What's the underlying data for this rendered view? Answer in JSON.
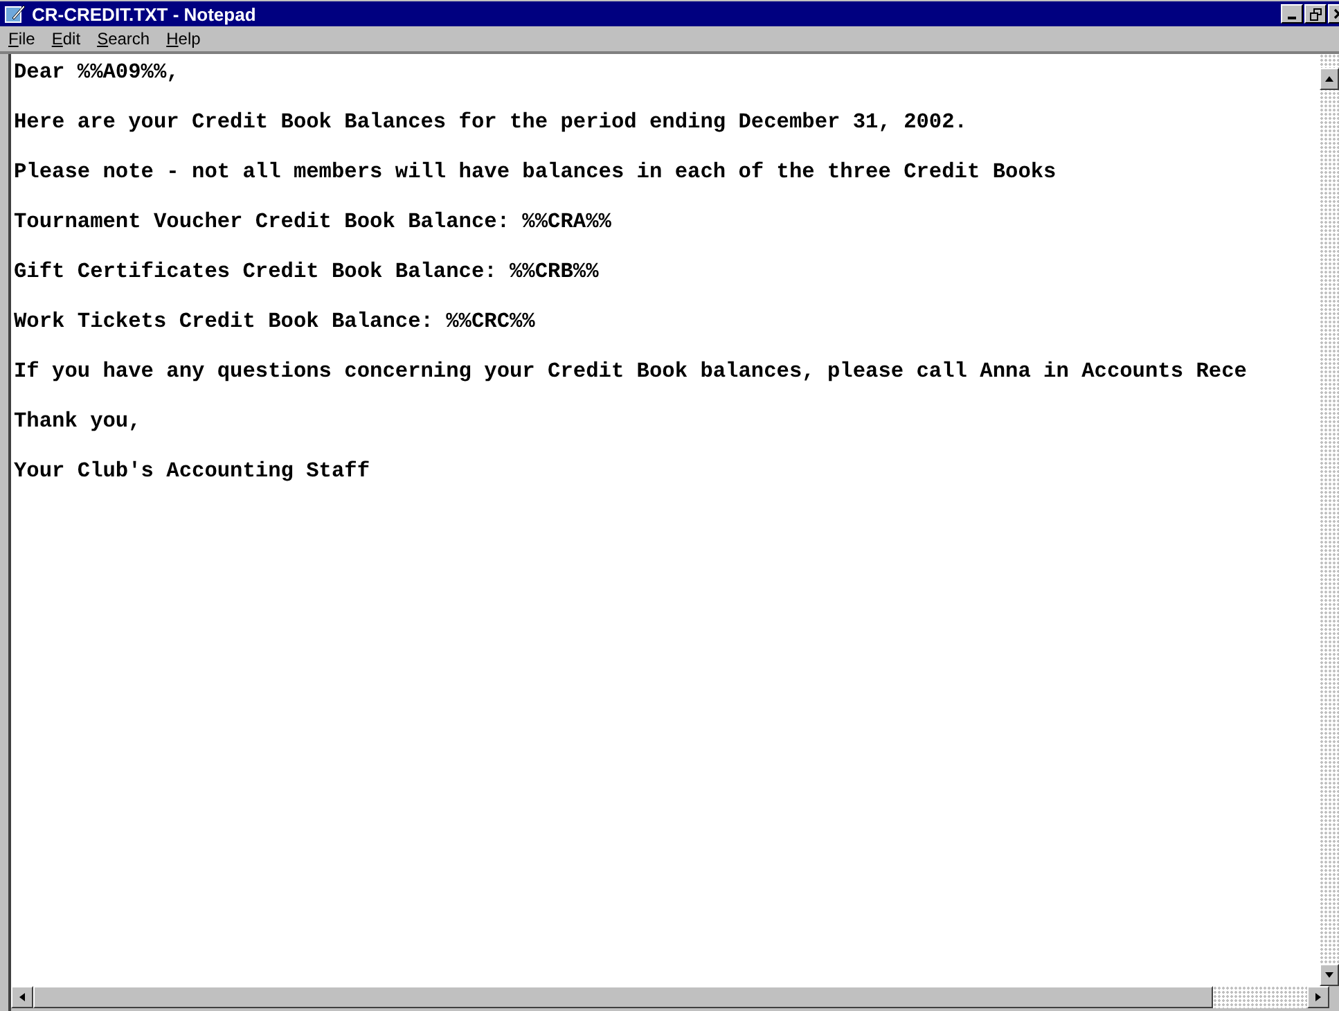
{
  "window": {
    "title": "CR-CREDIT.TXT - Notepad"
  },
  "menu": [
    "File",
    "Edit",
    "Search",
    "Help"
  ],
  "document": {
    "lines": [
      "Dear %%A09%%,",
      "Here are your Credit Book Balances for the period ending December 31, 2002.",
      "Please note - not all members will have balances in each of the three Credit Books",
      "Tournament Voucher Credit Book Balance: %%CRA%%",
      "Gift Certificates Credit Book Balance: %%CRB%%",
      "Work Tickets Credit Book Balance: %%CRC%%",
      "If you have any questions concerning your Credit Book balances, please call Anna in Accounts Rece",
      "Thank you,",
      "Your Club's Accounting Staff"
    ]
  }
}
